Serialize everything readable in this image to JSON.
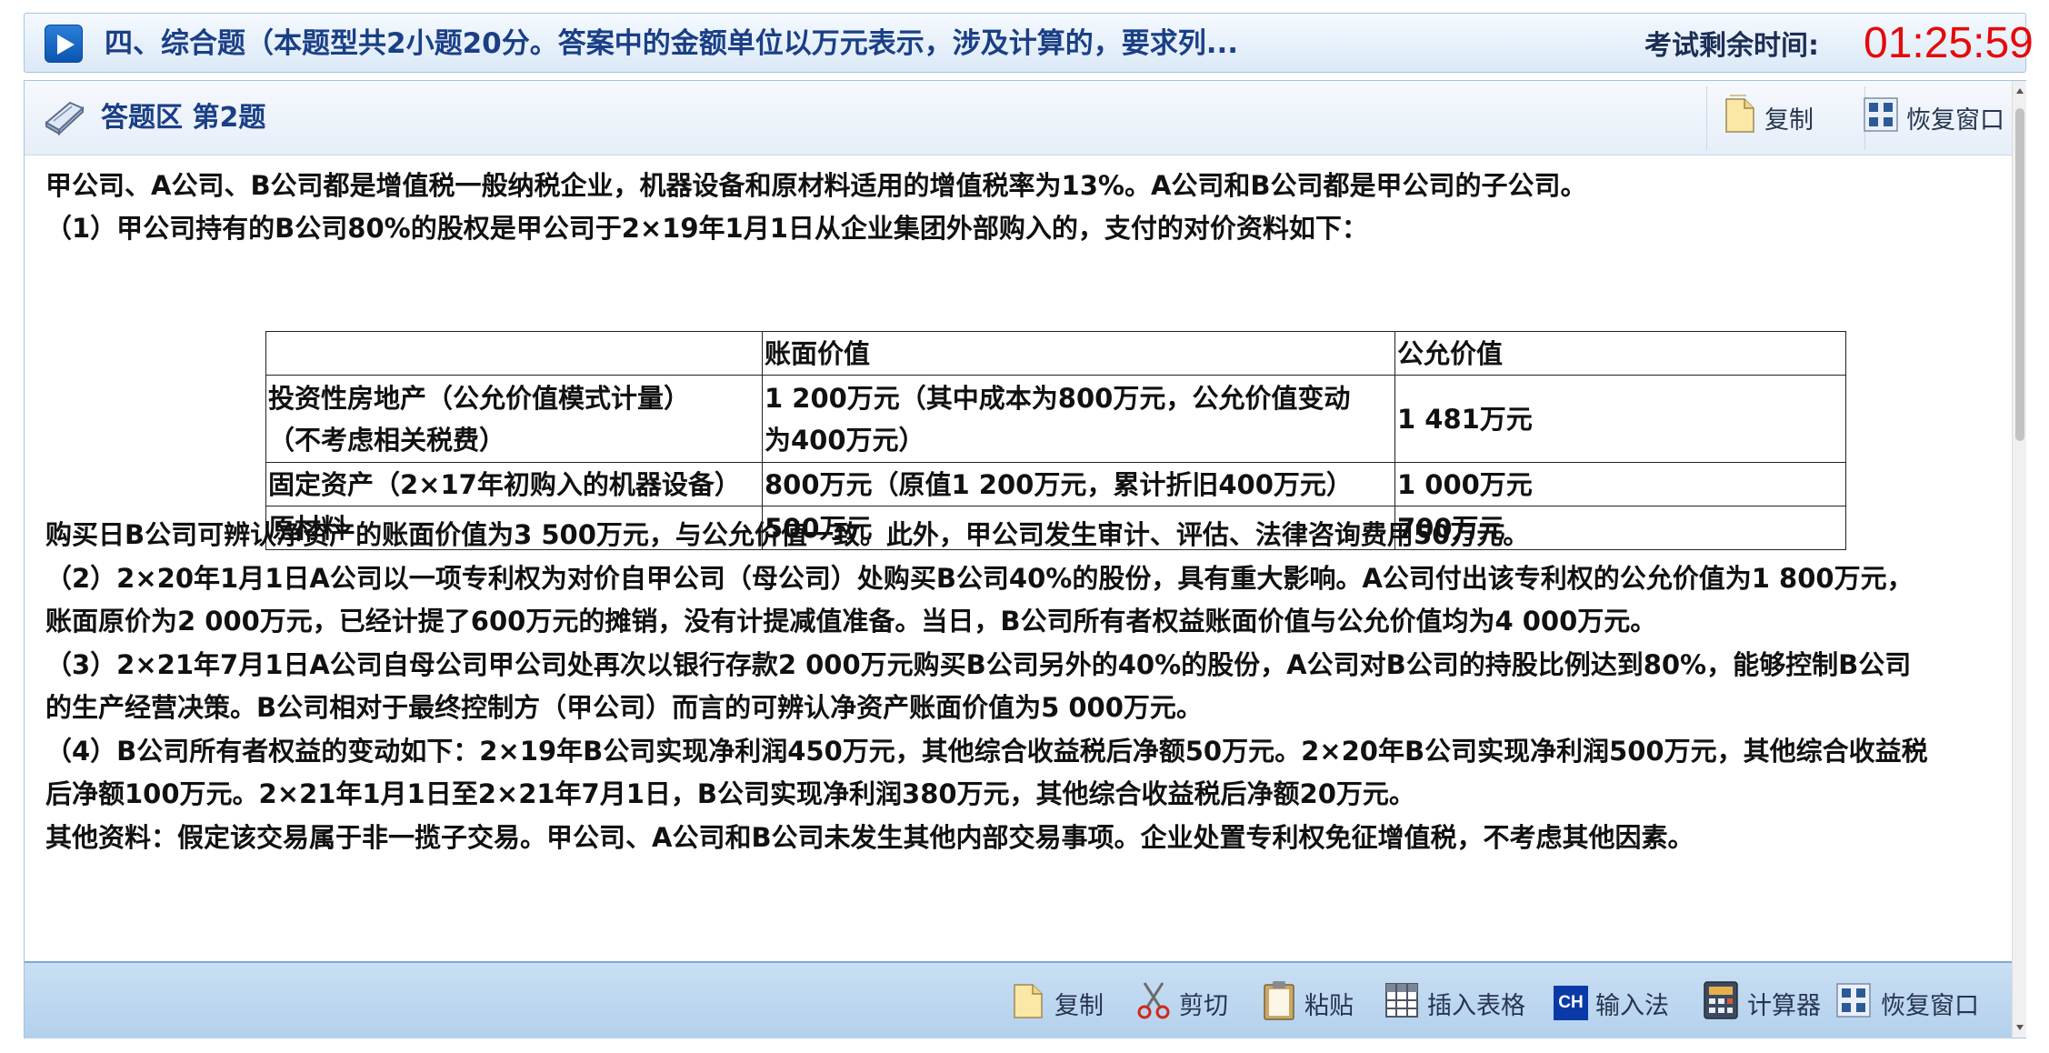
{
  "header": {
    "title": "四、综合题（本题型共2小题20分。答案中的金额单位以万元表示，涉及计算的，要求列...",
    "timer_label": "考试剩余时间:",
    "timer_value": "01:25:59"
  },
  "panel": {
    "title": "答题区 第2题",
    "copy_label": "复制",
    "restore_label": "恢复窗口"
  },
  "question": {
    "intro": "甲公司、A公司、B公司都是增值税一般纳税企业，机器设备和原材料适用的增值税率为13%。A公司和B公司都是甲公司的子公司。",
    "item1": "（1）甲公司持有的B公司80%的股权是甲公司于2×19年1月1日从企业集团外部购入的，支付的对价资料如下：",
    "table": {
      "headers": [
        "",
        "账面价值",
        "公允价值"
      ],
      "rows": [
        [
          "投资性房地产（公允价值模式计量）（不考虑相关税费）",
          "1 200万元（其中成本为800万元，公允价值变动为400万元）",
          "1 481万元"
        ],
        [
          "固定资产（2×17年初购入的机器设备）",
          "800万元（原值1 200万元，累计折旧400万元）",
          "1 000万元"
        ],
        [
          "原材料",
          "500万元",
          "700万元"
        ]
      ],
      "row1_col1_line1": "投资性房地产（公允价值模式计量）",
      "row1_col1_line2": "（不考虑相关税费）",
      "row1_col2_line1": "1 200万元（其中成本为800万元，公允价值变动",
      "row1_col2_line2": "为400万元）"
    },
    "p1": "购买日B公司可辨认净资产的账面价值为3 500万元，与公允价值一致。此外，甲公司发生审计、评估、法律咨询费用50万元。",
    "p2_l1": "（2）2×20年1月1日A公司以一项专利权为对价自甲公司（母公司）处购买B公司40%的股份，具有重大影响。A公司付出该专利权的公允价值为1 800万元，",
    "p2_l2": "账面原价为2 000万元，已经计提了600万元的摊销，没有计提减值准备。当日，B公司所有者权益账面价值与公允价值均为4 000万元。",
    "p3_l1": "（3）2×21年7月1日A公司自母公司甲公司处再次以银行存款2 000万元购买B公司另外的40%的股份，A公司对B公司的持股比例达到80%，能够控制B公司",
    "p3_l2": "的生产经营决策。B公司相对于最终控制方（甲公司）而言的可辨认净资产账面价值为5 000万元。",
    "p4_l1": "（4）B公司所有者权益的变动如下：2×19年B公司实现净利润450万元，其他综合收益税后净额50万元。2×20年B公司实现净利润500万元，其他综合收益税",
    "p4_l2": "后净额100万元。2×21年1月1日至2×21年7月1日，B公司实现净利润380万元，其他综合收益税后净额20万元。",
    "p5": "其他资料：假定该交易属于非一揽子交易。甲公司、A公司和B公司未发生其他内部交易事项。企业处置专利权免征增值税，不考虑其他因素。"
  },
  "toolbar": {
    "copy": "复制",
    "cut": "剪切",
    "paste": "粘贴",
    "insert_table": "插入表格",
    "input_method": "输入法",
    "input_method_badge": "CH",
    "calculator": "计算器",
    "restore": "恢复窗口"
  },
  "colors": {
    "accent": "#1a3f86",
    "timer": "#e50a0a",
    "toolbar_bg": "#c2d9f0"
  }
}
